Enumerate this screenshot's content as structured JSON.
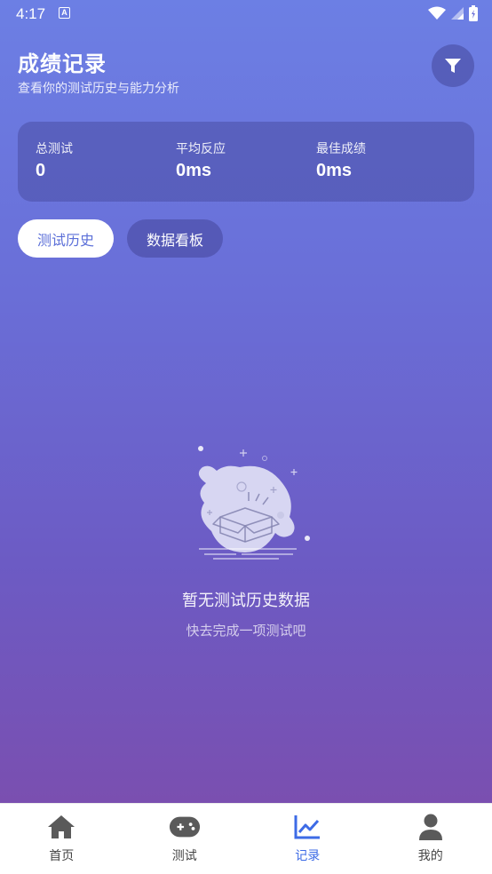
{
  "status_bar": {
    "time": "4:17"
  },
  "header": {
    "title": "成绩记录",
    "subtitle": "查看你的测试历史与能力分析"
  },
  "stats": [
    {
      "label": "总测试",
      "value": "0"
    },
    {
      "label": "平均反应",
      "value": "0ms"
    },
    {
      "label": "最佳成绩",
      "value": "0ms"
    }
  ],
  "tabs": [
    {
      "label": "测试历史",
      "active": true
    },
    {
      "label": "数据看板",
      "active": false
    }
  ],
  "empty_state": {
    "title": "暂无测试历史数据",
    "subtitle": "快去完成一项测试吧"
  },
  "bottom_nav": [
    {
      "label": "首页",
      "icon": "home-icon"
    },
    {
      "label": "测试",
      "icon": "gamepad-icon"
    },
    {
      "label": "记录",
      "icon": "chart-line-icon",
      "active": true
    },
    {
      "label": "我的",
      "icon": "person-icon"
    }
  ],
  "colors": {
    "accent": "#3d6be6",
    "gradient_top": "#6c7fe4",
    "gradient_bottom": "#7a4fb0"
  }
}
